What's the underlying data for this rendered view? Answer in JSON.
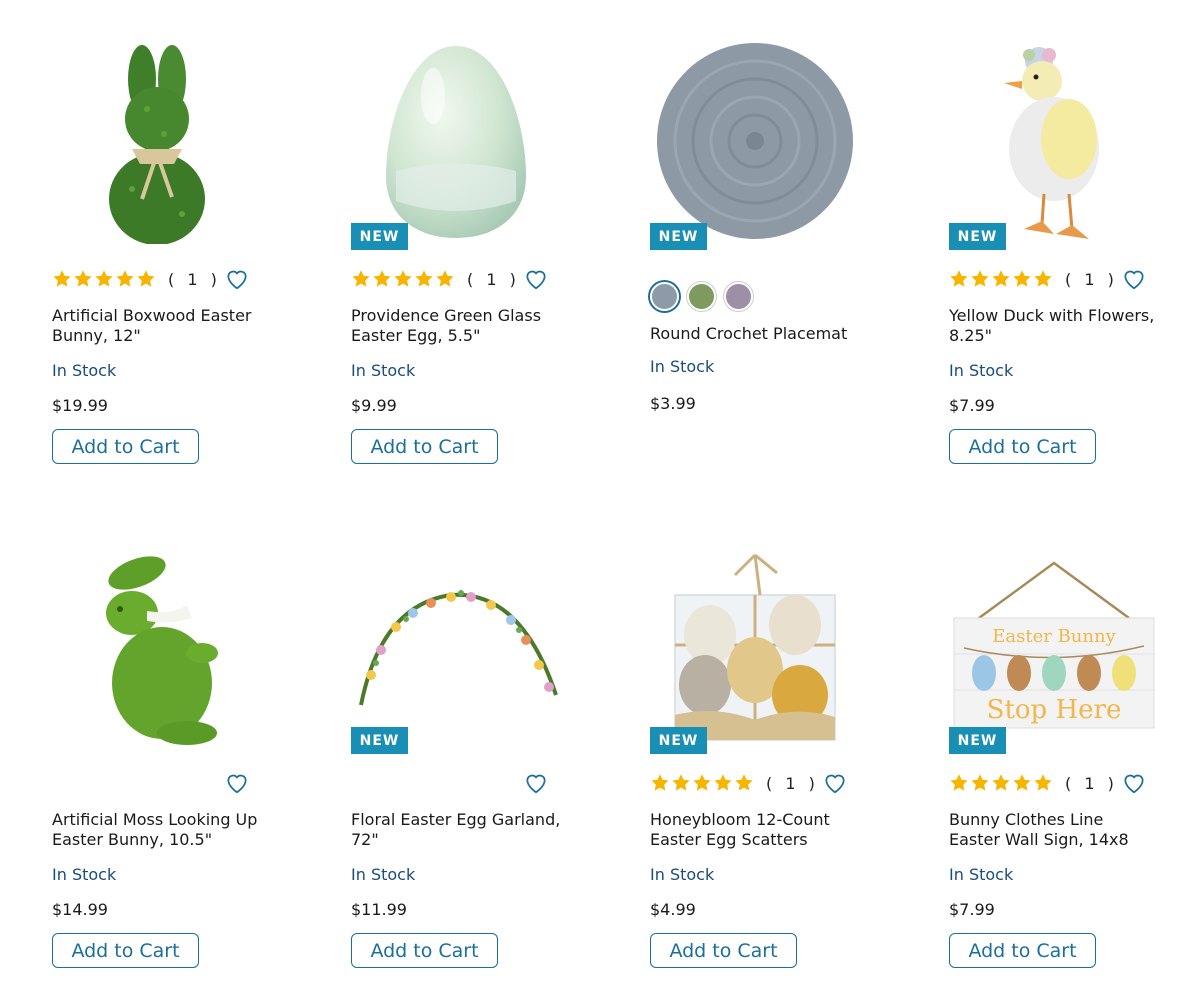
{
  "colors": {
    "accent": "#1a6f9b",
    "badge_bg": "#1a8fb5",
    "stock_text": "#1a4c7c",
    "star": "#f7b500"
  },
  "products": [
    {
      "name": "Artificial Boxwood Easter Bunny, 12\"",
      "rating_count": "( 1 )",
      "stock": "In Stock",
      "price": "$19.99",
      "cart_label": "Add to Cart",
      "badge": "",
      "image_icon": "boxwood-bunny-image"
    },
    {
      "name": "Providence Green Glass Easter Egg, 5.5\"",
      "rating_count": "( 1 )",
      "stock": "In Stock",
      "price": "$9.99",
      "cart_label": "Add to Cart",
      "badge": "NEW",
      "image_icon": "glass-egg-image"
    },
    {
      "name": "Round Crochet Placemat",
      "stock": "In Stock",
      "price": "$3.99",
      "badge": "NEW",
      "swatch_colors": [
        "#8e9aa8",
        "#7f9a5e",
        "#9d8fa6"
      ],
      "image_icon": "crochet-placemat-image"
    },
    {
      "name": "Yellow Duck with Flowers, 8.25\"",
      "rating_count": "( 1 )",
      "stock": "In Stock",
      "price": "$7.99",
      "cart_label": "Add to Cart",
      "badge": "NEW",
      "image_icon": "yellow-duck-image"
    },
    {
      "name": "Artificial Moss Looking Up Easter Bunny, 10.5\"",
      "stock": "In Stock",
      "price": "$14.99",
      "cart_label": "Add to Cart",
      "badge": "",
      "image_icon": "moss-bunny-image"
    },
    {
      "name": "Floral Easter Egg Garland, 72\"",
      "stock": "In Stock",
      "price": "$11.99",
      "cart_label": "Add to Cart",
      "badge": "NEW",
      "image_icon": "floral-garland-image"
    },
    {
      "name": "Honeybloom 12-Count Easter Egg Scatters",
      "rating_count": "( 1 )",
      "stock": "In Stock",
      "price": "$4.99",
      "cart_label": "Add to Cart",
      "badge": "NEW",
      "image_icon": "egg-scatters-image"
    },
    {
      "name": "Bunny Clothes Line Easter Wall Sign, 14x8",
      "rating_count": "( 1 )",
      "stock": "In Stock",
      "price": "$7.99",
      "cart_label": "Add to Cart",
      "badge": "NEW",
      "image_icon": "wall-sign-image",
      "sign_text_top": "Easter Bunny",
      "sign_text_bottom": "Stop Here"
    }
  ]
}
